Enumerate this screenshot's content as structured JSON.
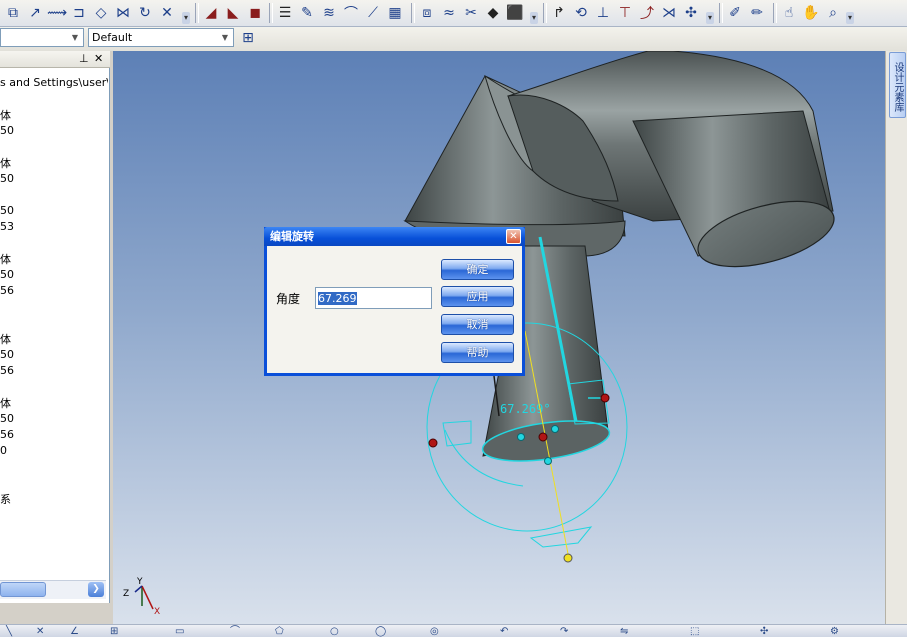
{
  "toolbar": {
    "combo_left": {
      "value": ""
    },
    "combo_style": {
      "value": "Default"
    }
  },
  "left_panel": {
    "path_text": "s and Settings\\user\\桌",
    "tree_lines": [
      "体",
      "50",
      "体",
      "50",
      "50",
      "53",
      "体",
      "50",
      "56",
      "体",
      "50",
      "56",
      "体",
      "50",
      "56",
      "0",
      "系"
    ]
  },
  "right_dock": {
    "tab_label": "设计元素库"
  },
  "viewport": {
    "angle_annotation": "67.269°"
  },
  "dialog": {
    "title": "编辑旋转",
    "angle_label": "角度",
    "angle_value": "67.269",
    "buttons": {
      "ok": "确定",
      "apply": "应用",
      "cancel": "取消",
      "help": "帮助"
    }
  },
  "triad": {
    "z_label": "Z",
    "y_label": "Y",
    "x_label": "X"
  },
  "colors": {
    "selection_cyan": "#22d6e0",
    "dialog_title_blue": "#0850d8",
    "handle_red": "#b01515",
    "handle_yellow": "#f0e020"
  }
}
